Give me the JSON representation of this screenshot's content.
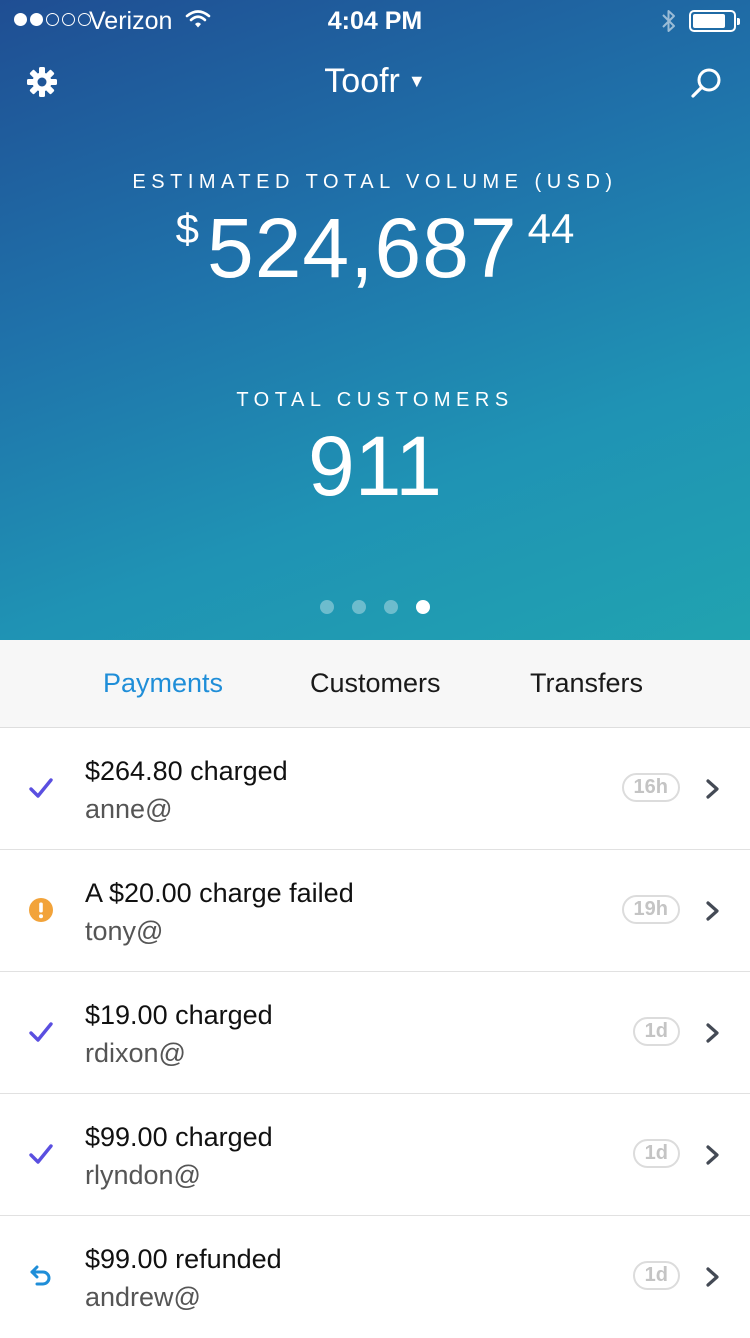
{
  "status_bar": {
    "carrier": "Verizon",
    "time": "4:04 PM"
  },
  "nav": {
    "account_name": "Toofr",
    "settings_icon": "gear-icon",
    "search_icon": "search-icon"
  },
  "hero": {
    "volume_label": "ESTIMATED TOTAL VOLUME (USD)",
    "volume_currency": "$",
    "volume_main": "524,687",
    "volume_cents": "44",
    "customers_label": "TOTAL CUSTOMERS",
    "customers_value": "911",
    "pager": {
      "page_count": 4,
      "active_page": 4
    }
  },
  "tabs": [
    {
      "label": "Payments",
      "active": true
    },
    {
      "label": "Customers",
      "active": false
    },
    {
      "label": "Transfers",
      "active": false
    }
  ],
  "payments": [
    {
      "title": "$264.80 charged",
      "customer": "anne@",
      "age": "16h",
      "status": "succeeded",
      "icon": "checkmark-icon"
    },
    {
      "title": "A $20.00 charge failed",
      "customer": "tony@",
      "age": "19h",
      "status": "failed",
      "icon": "warning-icon"
    },
    {
      "title": "$19.00 charged",
      "customer": "rdixon@",
      "age": "1d",
      "status": "succeeded",
      "icon": "checkmark-icon"
    },
    {
      "title": "$99.00 charged",
      "customer": "rlyndon@",
      "age": "1d",
      "status": "succeeded",
      "icon": "checkmark-icon"
    },
    {
      "title": "$99.00 refunded",
      "customer": "andrew@",
      "age": "1d",
      "status": "refunded",
      "icon": "refund-icon"
    }
  ],
  "colors": {
    "accent": "#1f8ed8",
    "success": "#5a4fe0",
    "warning": "#f2a33a",
    "refund": "#1f8ed8",
    "hero_gradient_start": "#1f4e93",
    "hero_gradient_end": "#21a3b0"
  }
}
